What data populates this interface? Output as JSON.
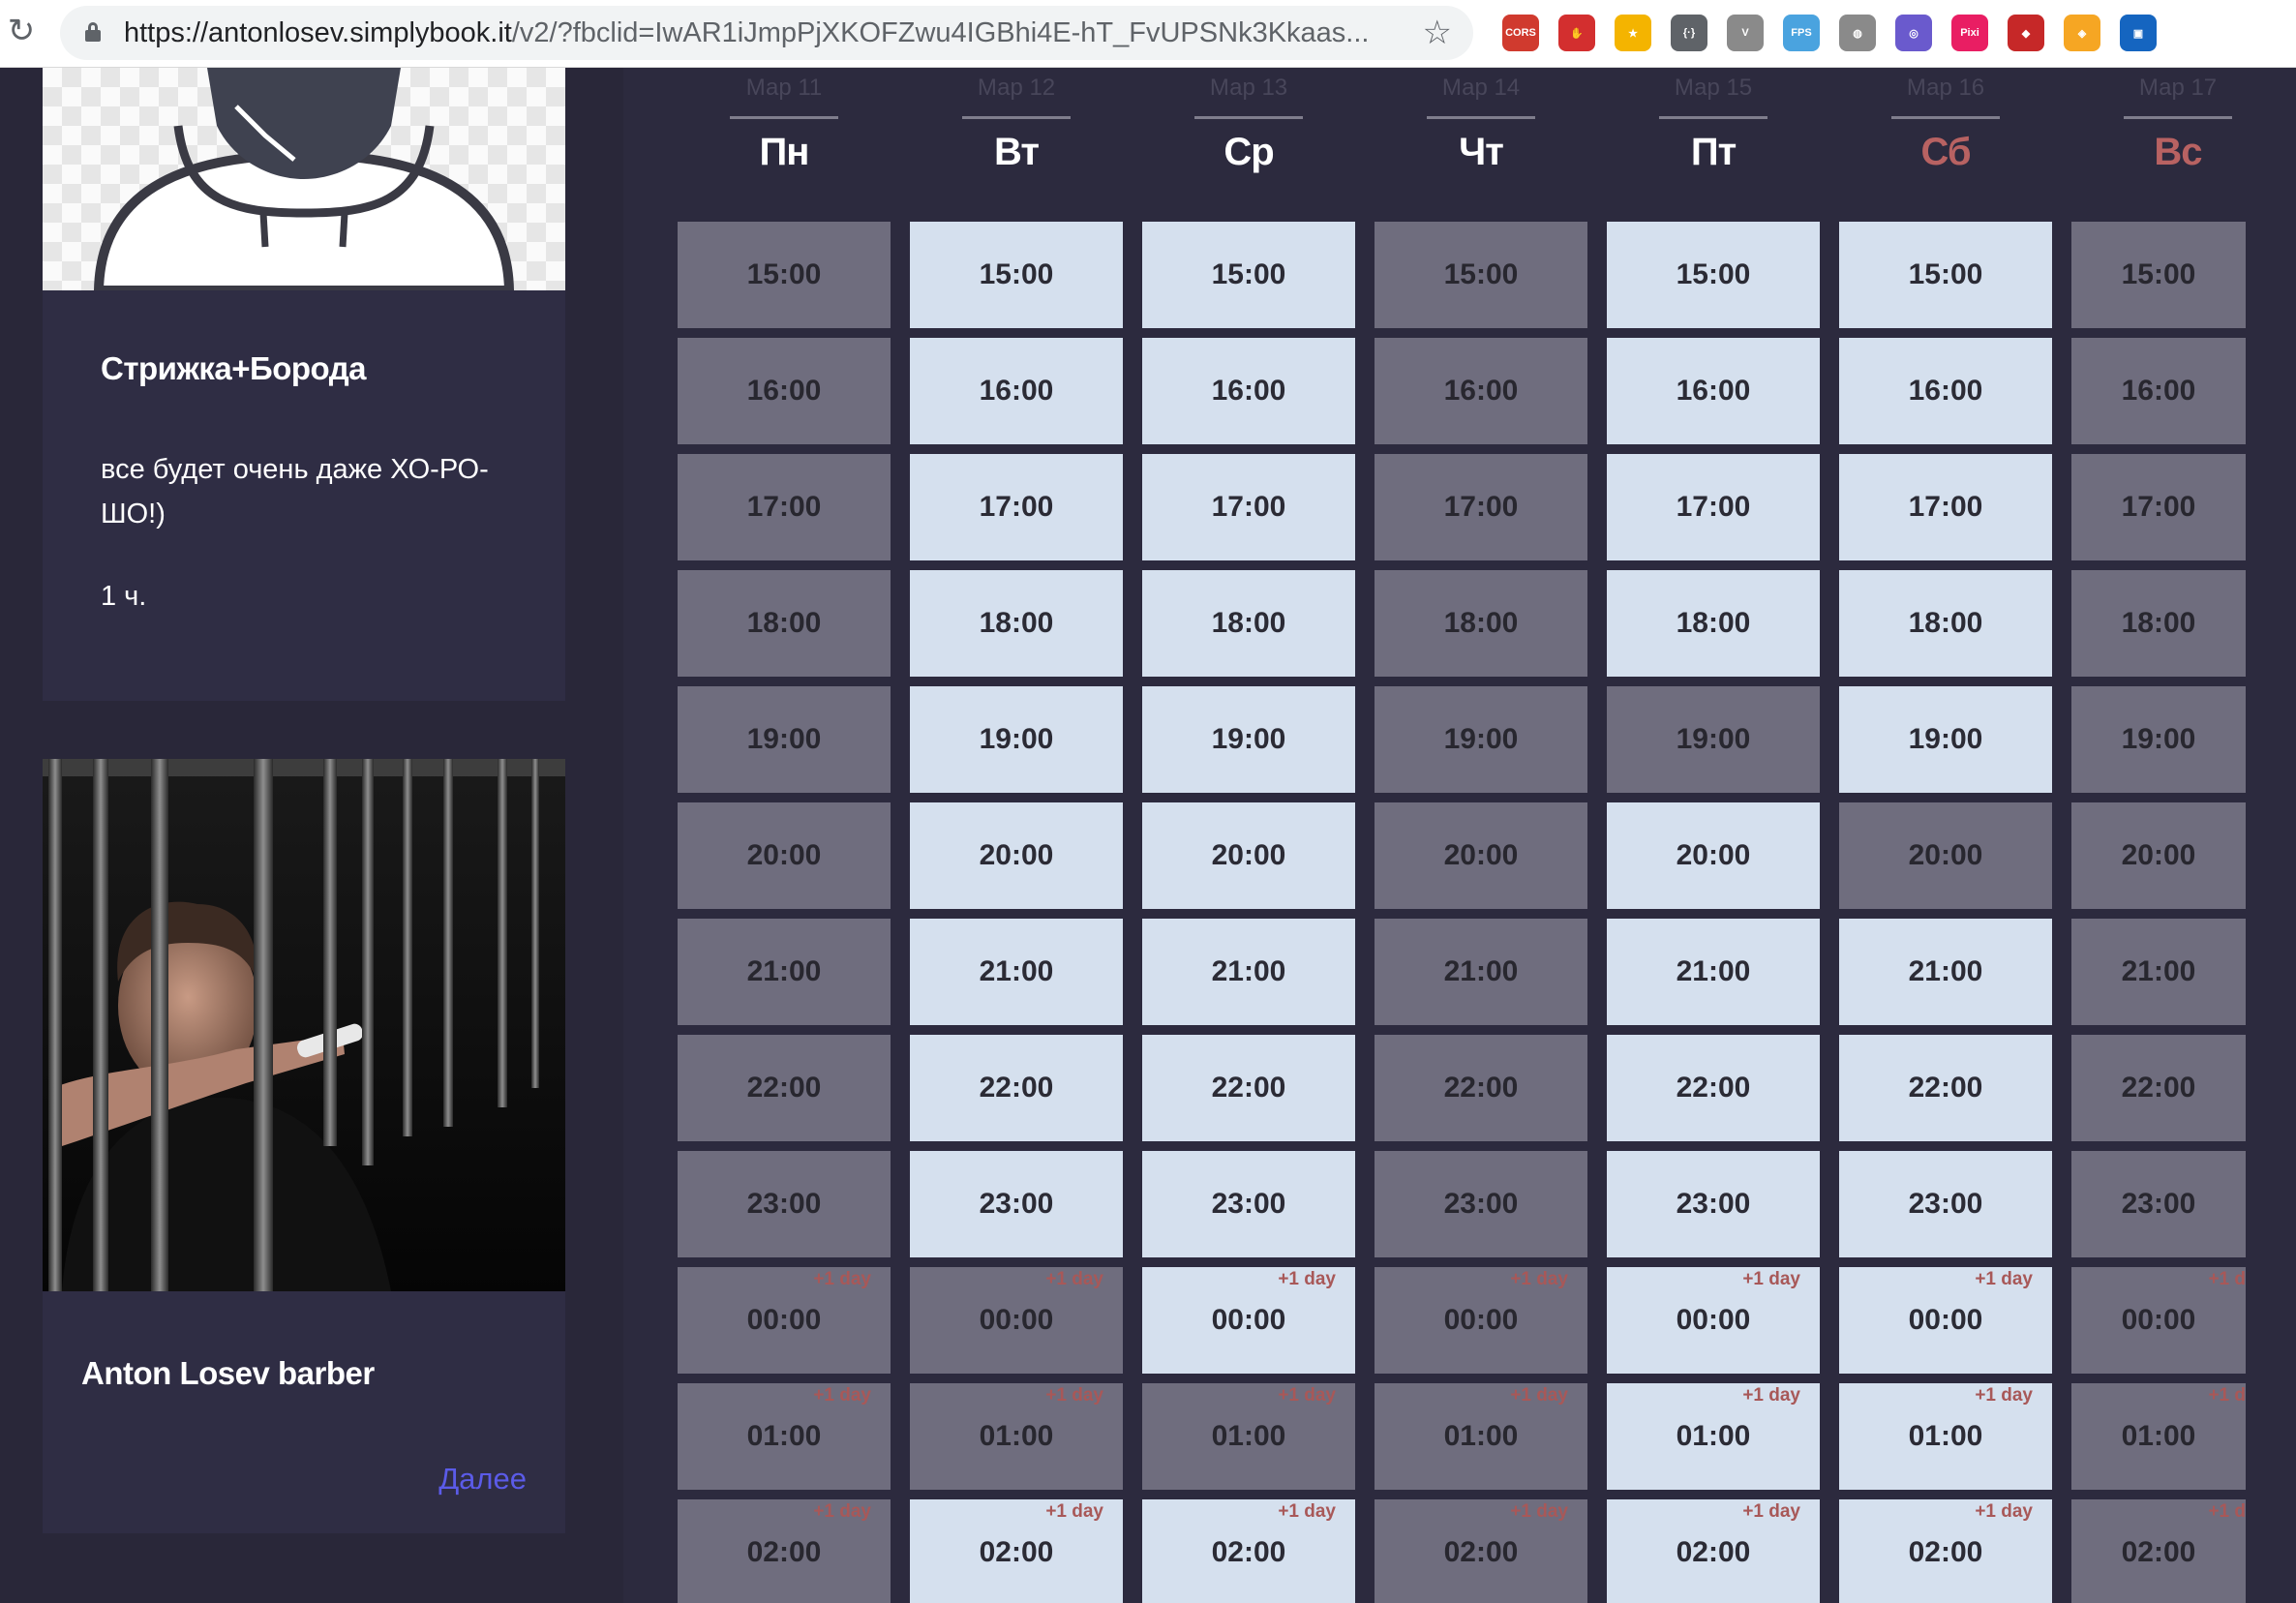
{
  "browser": {
    "url_host": "https://antonlosev.simplybook.it",
    "url_rest": "/v2/?fbclid=IwAR1iJmpPjXKOFZwu4IGBhi4E-hT_FvUPSNk3Kkaas...",
    "extensions": [
      {
        "name": "cors-extension-icon",
        "label": "CORS",
        "color": "#d03a2e"
      },
      {
        "name": "stop-hand-extension-icon",
        "label": "✋",
        "color": "#d32f2f"
      },
      {
        "name": "star-extension-icon",
        "label": "★",
        "color": "#f4b400"
      },
      {
        "name": "json-viewer-extension-icon",
        "label": "{·}",
        "color": "#5f6368"
      },
      {
        "name": "vue-devtools-extension-icon",
        "label": "V",
        "color": "#8a8a8a"
      },
      {
        "name": "fps-extension-icon",
        "label": "FPS",
        "color": "#4aa3df"
      },
      {
        "name": "globe-extension-icon",
        "label": "◍",
        "color": "#8a8a8a"
      },
      {
        "name": "swirl-extension-icon",
        "label": "◎",
        "color": "#6a5acd"
      },
      {
        "name": "pixi-devtools-extension-icon",
        "label": "Pixi",
        "color": "#e91e63"
      },
      {
        "name": "react-extension-icon",
        "label": "◆",
        "color": "#c62828"
      },
      {
        "name": "orange-extension-icon",
        "label": "◈",
        "color": "#f6a623"
      },
      {
        "name": "image-extension-icon",
        "label": "▣",
        "color": "#1565c0"
      }
    ]
  },
  "service": {
    "title": "Стрижка+Борода",
    "description": "все будет очень даже ХО-РО-ШО!)",
    "duration": "1 ч."
  },
  "provider": {
    "name": "Anton Losev barber",
    "more_label": "Далее"
  },
  "calendar": {
    "days": [
      {
        "date": "Мар 11",
        "name": "Пн",
        "weekend": false
      },
      {
        "date": "Мар 12",
        "name": "Вт",
        "weekend": false
      },
      {
        "date": "Мар 13",
        "name": "Ср",
        "weekend": false
      },
      {
        "date": "Мар 14",
        "name": "Чт",
        "weekend": false
      },
      {
        "date": "Мар 15",
        "name": "Пт",
        "weekend": false
      },
      {
        "date": "Мар 16",
        "name": "Сб",
        "weekend": true
      },
      {
        "date": "Мар 17",
        "name": "Вс",
        "weekend": true
      }
    ],
    "next_day_label": "+1 day",
    "next_day_label_cut": "+1 d",
    "times": [
      "15:00",
      "16:00",
      "17:00",
      "18:00",
      "19:00",
      "20:00",
      "21:00",
      "22:00",
      "23:00",
      "00:00",
      "01:00",
      "02:00"
    ],
    "next_day_from_index": 9,
    "availability": [
      [
        0,
        1,
        1,
        0,
        1,
        1,
        0
      ],
      [
        0,
        1,
        1,
        0,
        1,
        1,
        0
      ],
      [
        0,
        1,
        1,
        0,
        1,
        1,
        0
      ],
      [
        0,
        1,
        1,
        0,
        1,
        1,
        0
      ],
      [
        0,
        1,
        1,
        0,
        0,
        1,
        0
      ],
      [
        0,
        1,
        1,
        0,
        1,
        0,
        0
      ],
      [
        0,
        1,
        1,
        0,
        1,
        1,
        0
      ],
      [
        0,
        1,
        1,
        0,
        1,
        1,
        0
      ],
      [
        0,
        1,
        1,
        0,
        1,
        1,
        0
      ],
      [
        0,
        0,
        1,
        0,
        1,
        1,
        0
      ],
      [
        0,
        0,
        0,
        0,
        1,
        1,
        0
      ],
      [
        0,
        1,
        1,
        0,
        1,
        1,
        0
      ]
    ]
  }
}
